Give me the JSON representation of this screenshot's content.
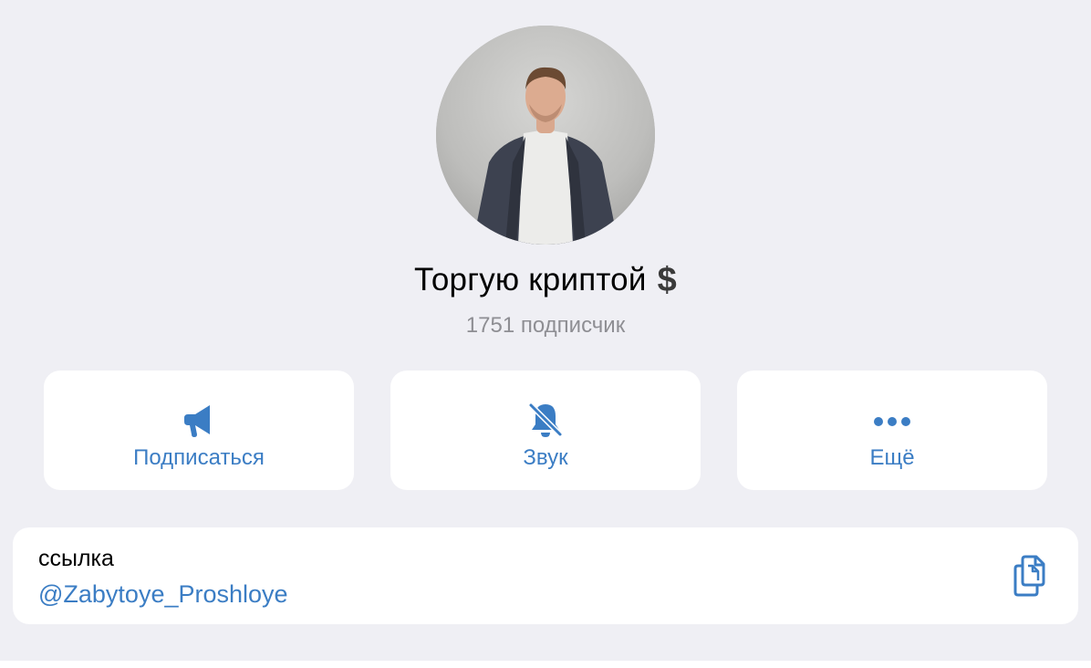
{
  "profile": {
    "title": "Торгую криптой",
    "title_emoji": "$",
    "subscribers": "1751 подписчик"
  },
  "actions": [
    {
      "label": "Подписаться",
      "icon": "megaphone-icon"
    },
    {
      "label": "Звук",
      "icon": "bell-slash-icon"
    },
    {
      "label": "Ещё",
      "icon": "more-dots-icon"
    }
  ],
  "link": {
    "label": "ссылка",
    "value": "@Zabytoye_Proshloye",
    "icon": "copy-icon"
  },
  "colors": {
    "accent": "#3b7dc4",
    "background": "#efeff4",
    "card": "#ffffff",
    "secondary_text": "#8e8e93"
  }
}
